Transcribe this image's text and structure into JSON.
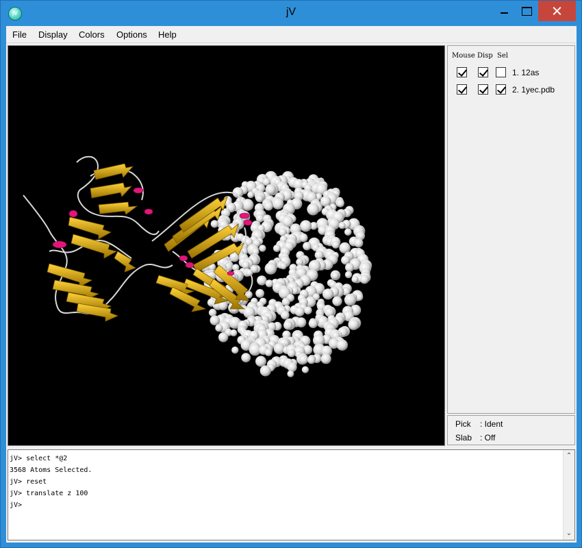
{
  "window": {
    "title": "jV",
    "icon": "jv-app-icon",
    "icon_text": "jV"
  },
  "menu": {
    "items": [
      "File",
      "Display",
      "Colors",
      "Options",
      "Help"
    ]
  },
  "models_panel": {
    "headers": {
      "mouse": "Mouse",
      "disp": "Disp",
      "sel": "Sel"
    },
    "models": [
      {
        "label": "1.  12as",
        "mouse": true,
        "disp": true,
        "sel": false
      },
      {
        "label": "2.  1yec.pdb",
        "mouse": true,
        "disp": true,
        "sel": true
      }
    ]
  },
  "status": {
    "pick": {
      "key": "Pick",
      "value": ": Ident"
    },
    "slab": {
      "key": "Slab",
      "value": ": Off"
    }
  },
  "console": {
    "lines": [
      "jV> select *@2",
      "3568 Atoms Selected.",
      "jV> reset",
      "jV> translate z 100",
      "jV>"
    ]
  },
  "colors": {
    "titlebar": "#2e8fd8",
    "close_button": "#c7463b",
    "ribbon_strand": "#e8b800",
    "ribbon_helix": "#e0167a",
    "coil": "#d8d8d8",
    "atom": "#ffffff",
    "viewer_bg": "#000000"
  }
}
